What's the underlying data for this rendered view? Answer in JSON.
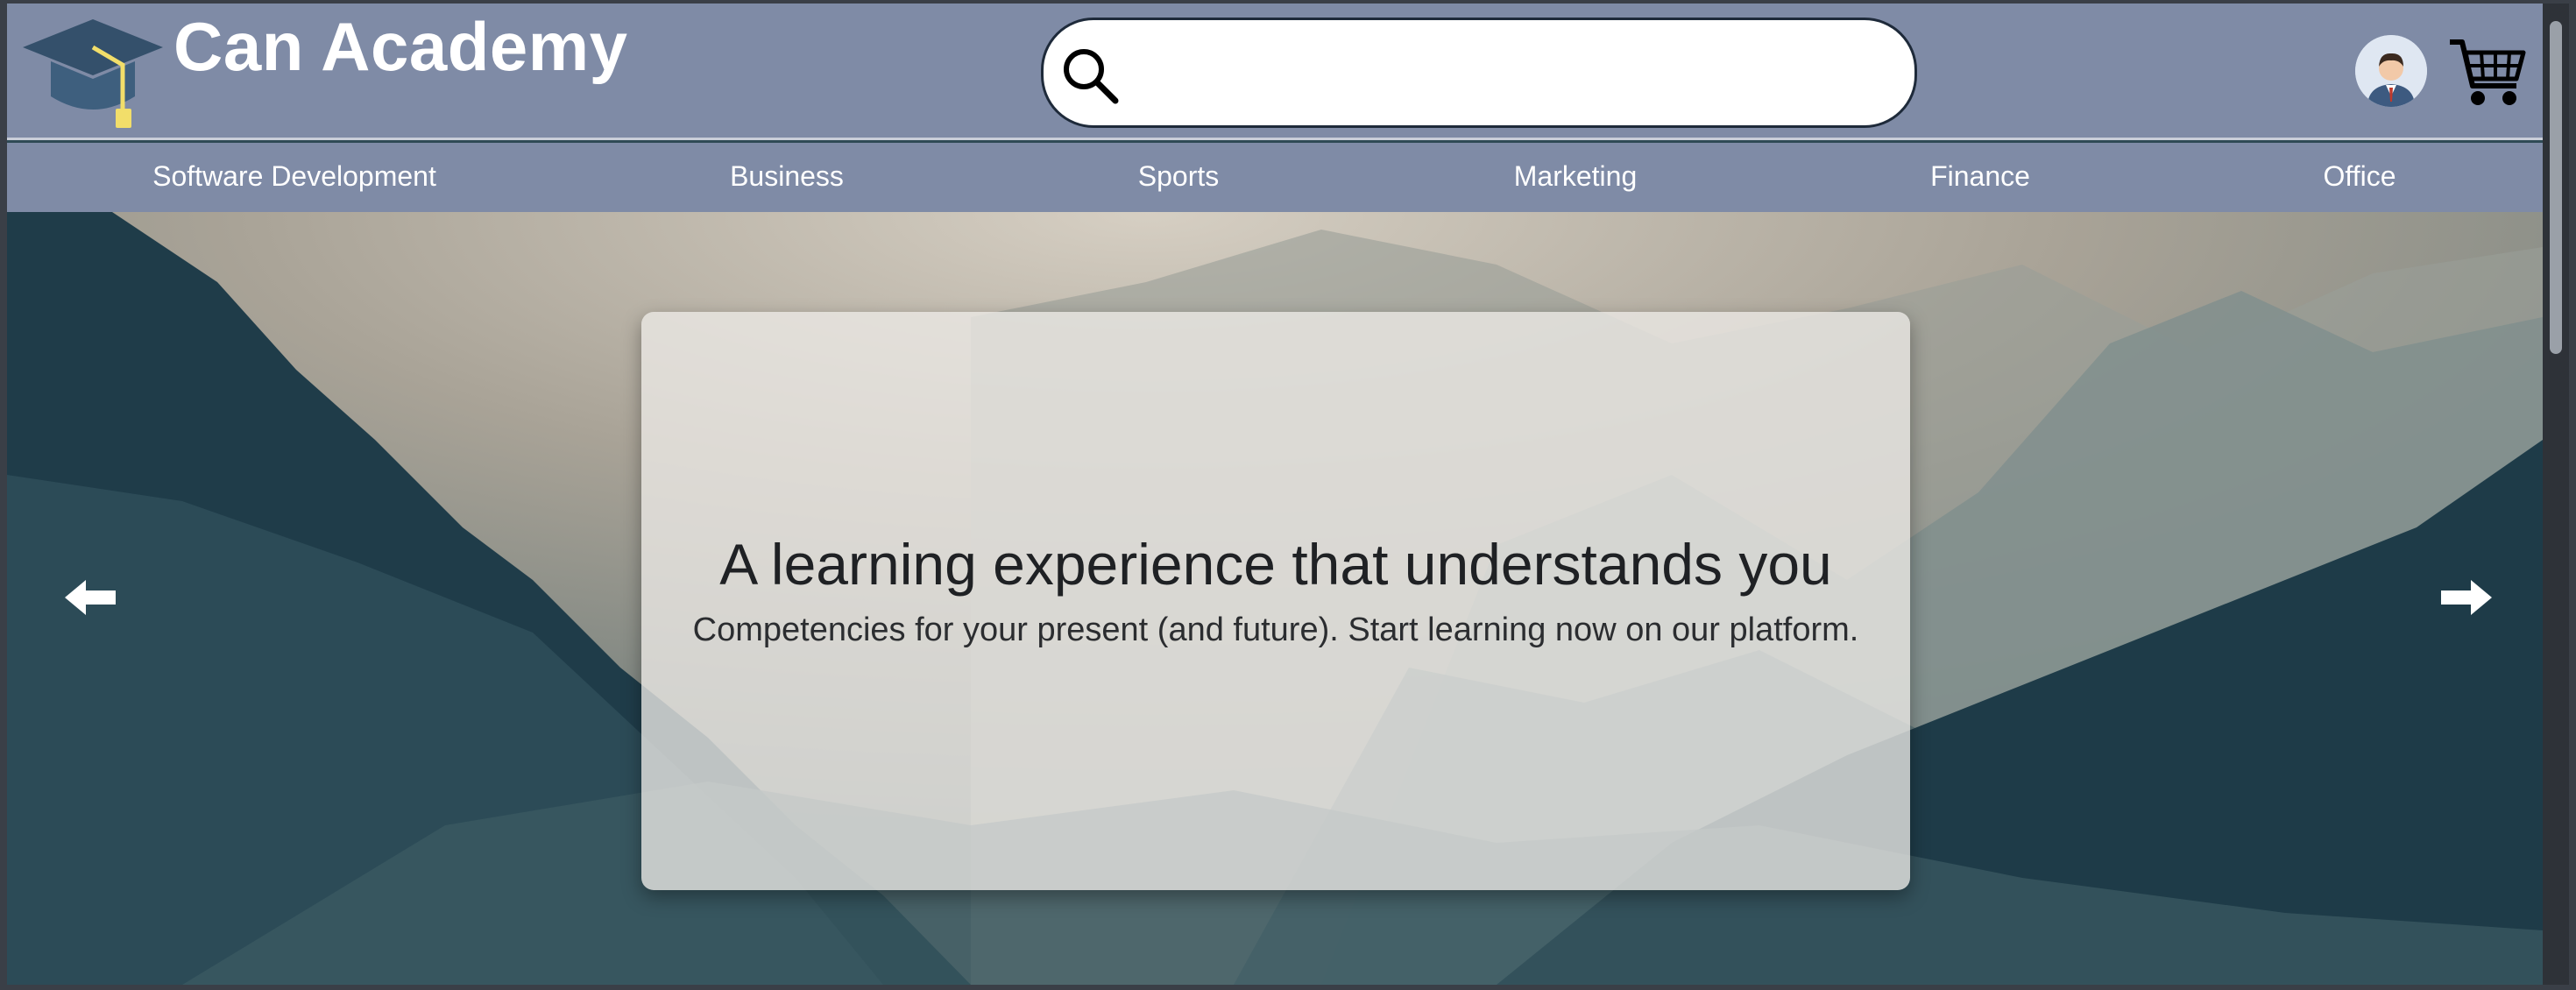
{
  "header": {
    "brand": "Can Academy",
    "icons": {
      "logo": "graduation-cap-icon",
      "search": "search-icon",
      "avatar": "user-avatar-icon",
      "cart": "shopping-cart-icon"
    }
  },
  "search": {
    "value": "",
    "placeholder": ""
  },
  "nav": {
    "items": [
      {
        "label": "Software Development"
      },
      {
        "label": "Business"
      },
      {
        "label": "Sports"
      },
      {
        "label": "Marketing"
      },
      {
        "label": "Finance"
      },
      {
        "label": "Office"
      }
    ]
  },
  "hero": {
    "title": "A learning experience that understands you",
    "subtitle": "Competencies for your present (and future). Start learning now on our platform.",
    "prev_icon": "arrow-left-icon",
    "next_icon": "arrow-right-icon"
  },
  "colors": {
    "header_bg": "#7f8ba6",
    "brand_text": "#ffffff",
    "card_bg": "#ece9e6"
  }
}
